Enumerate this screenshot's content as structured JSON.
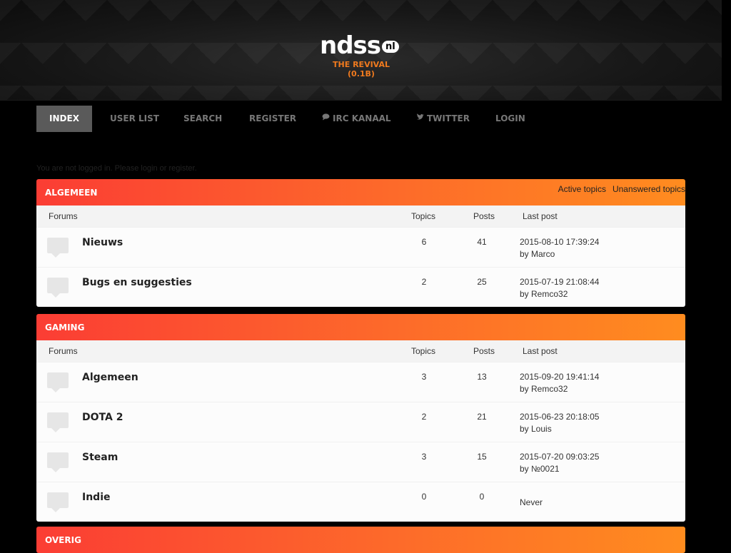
{
  "header": {
    "logo_text": "ndss",
    "logo_badge": "nl",
    "tagline": "THE REVIVAL (0.1B)"
  },
  "nav": [
    {
      "label": "INDEX",
      "icon": ""
    },
    {
      "label": "USER LIST",
      "icon": ""
    },
    {
      "label": "SEARCH",
      "icon": ""
    },
    {
      "label": "REGISTER",
      "icon": ""
    },
    {
      "label": "IRC KANAAL",
      "icon": "chat-icon"
    },
    {
      "label": "TWITTER",
      "icon": "twitter-icon"
    },
    {
      "label": "LOGIN",
      "icon": ""
    }
  ],
  "notice": "You are not logged in. Please login or register.",
  "columns": {
    "forums": "Forums",
    "topics": "Topics",
    "posts": "Posts",
    "last_post": "Last post"
  },
  "categories": [
    {
      "title": "ALGEMEEN",
      "links": [
        "Active topics",
        "Unanswered topics"
      ],
      "forums": [
        {
          "name": "Nieuws",
          "topics": "6",
          "posts": "41",
          "last_date": "2015-08-10 17:39:24",
          "last_by": "by Marco"
        },
        {
          "name": "Bugs en suggesties",
          "topics": "2",
          "posts": "25",
          "last_date": "2015-07-19 21:08:44",
          "last_by": "by Remco32"
        }
      ]
    },
    {
      "title": "GAMING",
      "links": [],
      "forums": [
        {
          "name": "Algemeen",
          "topics": "3",
          "posts": "13",
          "last_date": "2015-09-20 19:41:14",
          "last_by": "by Remco32"
        },
        {
          "name": "DOTA 2",
          "topics": "2",
          "posts": "21",
          "last_date": "2015-06-23 20:18:05",
          "last_by": "by Louis"
        },
        {
          "name": "Steam",
          "topics": "3",
          "posts": "15",
          "last_date": "2015-07-20 09:03:25",
          "last_by": "by №0021"
        },
        {
          "name": "Indie",
          "topics": "0",
          "posts": "0",
          "last_date": "Never",
          "last_by": ""
        }
      ]
    },
    {
      "title": "OVERIG",
      "links": [],
      "forums": []
    }
  ]
}
